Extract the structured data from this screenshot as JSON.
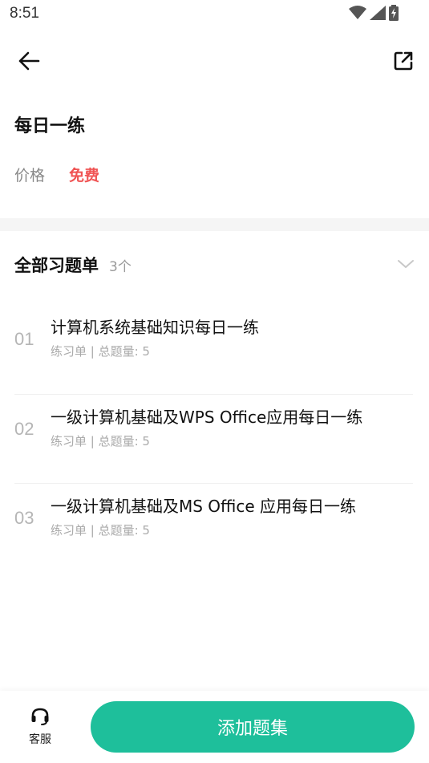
{
  "status_bar": {
    "time": "8:51",
    "icons": [
      "wifi-icon",
      "signal-icon",
      "battery-charging-icon"
    ]
  },
  "nav": {
    "back_icon": "arrow-left-icon",
    "share_icon": "share-external-icon"
  },
  "detail": {
    "title": "每日一练",
    "price_label": "价格",
    "price_value": "免费"
  },
  "section": {
    "title": "全部习题单",
    "count": "3个",
    "collapse_icon": "chevron-down-icon"
  },
  "items": [
    {
      "index": "01",
      "title": "计算机系统基础知识每日一练",
      "subtitle": "练习单 | 总题量: 5"
    },
    {
      "index": "02",
      "title": "一级计算机基础及WPS Office应用每日一练",
      "subtitle": "练习单 | 总题量: 5"
    },
    {
      "index": "03",
      "title": "一级计算机基础及MS Office 应用每日一练",
      "subtitle": "练习单 | 总题量: 5"
    }
  ],
  "bottom": {
    "service_label": "客服",
    "service_icon": "headset-icon",
    "add_button": "添加题集"
  },
  "colors": {
    "accent": "#1ebf9b",
    "price": "#f05454"
  }
}
